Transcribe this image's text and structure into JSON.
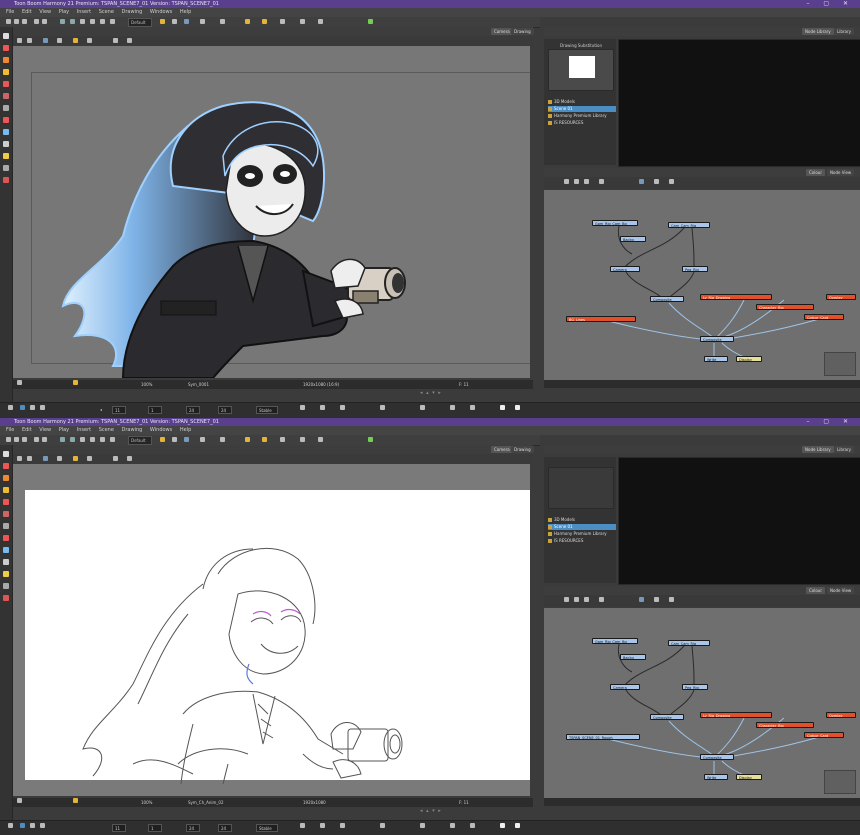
{
  "windows": [
    {
      "title": "Toon Boom Harmony 21 Premium: TSPAN_SCENE7_01 Version: TSPAN_SCENE7_01",
      "menu": [
        "File",
        "Edit",
        "View",
        "Play",
        "Insert",
        "Scene",
        "Drawing",
        "Windows",
        "Help"
      ],
      "toolbar": {
        "preset": "Default"
      },
      "camera_tabs": [
        "Camera",
        "Drawing"
      ],
      "camera_status": {
        "zoom": "100%",
        "view": "Sym_0001",
        "coords": "1920x1080 (16:9)",
        "frame_label": "F: 11"
      },
      "right_tabs": [
        "Node Library",
        "Library"
      ],
      "library": {
        "preview_label": "Drawing Substitution",
        "tree": [
          "3D Models",
          "Scene 01",
          "Harmony Premium Library",
          "IS RESOURCES"
        ],
        "selected_index": 1
      },
      "node_tabs": [
        "Colour",
        "Node View"
      ],
      "nodes": [
        {
          "label": "Gam_Rig_Cam_Bg",
          "color": "blue"
        },
        {
          "label": "Cam_Cam_Rig",
          "color": "blue"
        },
        {
          "label": "Backg",
          "color": "blue"
        },
        {
          "label": "Camera",
          "color": "blue"
        },
        {
          "label": "Peg_Rig",
          "color": "blue"
        },
        {
          "label": "Composite",
          "color": "blue"
        },
        {
          "label": "Ly_Rig_Drawing",
          "color": "red"
        },
        {
          "label": "Character_Rig",
          "color": "red"
        },
        {
          "label": "Colour_Card",
          "color": "red"
        },
        {
          "label": "BG_Lines",
          "color": "red"
        },
        {
          "label": "Overlay",
          "color": "red"
        },
        {
          "label": "Composite",
          "color": "blue"
        },
        {
          "label": "Write",
          "color": "blue"
        },
        {
          "label": "Display",
          "color": "yellow"
        }
      ]
    },
    {
      "title": "Toon Boom Harmony 21 Premium: TSPAN_SCENE7_01 Version: TSPAN_SCENE7_01",
      "menu": [
        "File",
        "Edit",
        "View",
        "Play",
        "Insert",
        "Scene",
        "Drawing",
        "Windows",
        "Help"
      ],
      "toolbar": {
        "preset": "Default"
      },
      "camera_tabs": [
        "Camera",
        "Drawing"
      ],
      "camera_status": {
        "zoom": "100%",
        "view": "Sym_Ch_Anim_02",
        "coords": "1920x1080",
        "frame_label": "F: 11"
      },
      "right_tabs": [
        "Node Library",
        "Library"
      ],
      "library": {
        "preview_label": "",
        "tree": [
          "3D Models",
          "Scene 01",
          "Harmony Premium Library",
          "IS RESOURCES"
        ],
        "selected_index": 1
      },
      "node_tabs": [
        "Colour",
        "Node View"
      ],
      "nodes": [
        {
          "label": "Gam_Rig_Cam_Bg",
          "color": "blue"
        },
        {
          "label": "Cam_Cam_Rig",
          "color": "blue"
        },
        {
          "label": "Backg",
          "color": "blue"
        },
        {
          "label": "Camera",
          "color": "blue"
        },
        {
          "label": "Peg_Rig",
          "color": "blue"
        },
        {
          "label": "Composite",
          "color": "blue"
        },
        {
          "label": "Ly_Rig_Drawing",
          "color": "red"
        },
        {
          "label": "Character_Rig",
          "color": "red"
        },
        {
          "label": "Colour_Card",
          "color": "red"
        },
        {
          "label": "TSPAN_SCENE_01_Rough",
          "color": "blue"
        },
        {
          "label": "Overlay",
          "color": "red"
        },
        {
          "label": "Composite",
          "color": "blue"
        },
        {
          "label": "Write",
          "color": "blue"
        },
        {
          "label": "Display",
          "color": "yellow"
        }
      ]
    }
  ],
  "timeline": {
    "frame": "11",
    "start": "1",
    "stop": "24",
    "fps": "24",
    "mode": "Stable"
  },
  "colors": {
    "accent": "#5a3f8f",
    "node_blue": "#a9c6ea",
    "node_red": "#e0502a",
    "selection": "#4a8ec4"
  }
}
